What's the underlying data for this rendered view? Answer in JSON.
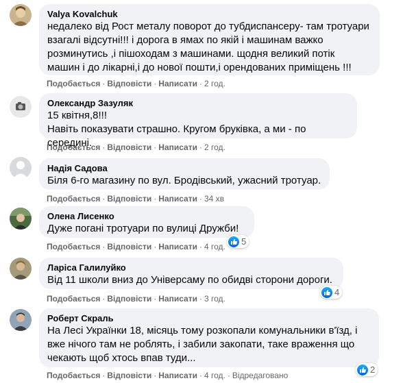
{
  "actions": {
    "like": "Подобається",
    "reply": "Відповісти",
    "write": "Написати",
    "edited": "Відредаговано"
  },
  "comments": [
    {
      "author": "Valya Kovalchuk",
      "lines": [
        "недалеко від Рост металу поворот до тубдиспансеру- там тротуари",
        "взагалі відсутні!!! і дорога в ямах по якій і машинам важко",
        "розминутись ,і пішоходам з машинами. щодня великий потік",
        "машин і до лікарні,і до нової пошти,і орендованих приміщень !!!"
      ],
      "time": "2 год."
    },
    {
      "author": "Олександр Зазуляк",
      "lines": [
        "15 квітня,8!!!",
        "Навіть показувати страшно. Кругом бруківка, а ми - по середині."
      ],
      "time": "2 год."
    },
    {
      "author": "Надія Садова",
      "lines": [
        "Біля 6-го магазину по вул. Бродівський, ужасний тротуар."
      ],
      "time": "34 хв"
    },
    {
      "author": "Олена Лисенко",
      "lines": [
        "Дуже погані тротуари по вулиці Дружби!"
      ],
      "time": "4 год.",
      "reactions": "5"
    },
    {
      "author": "Ларіса Галилуйко",
      "lines": [
        "Від 11 школи вниз до Універсаму по обидві сторони дороги."
      ],
      "time": "3 год.",
      "reactions": "4"
    },
    {
      "author": "Роберт Скраль",
      "lines": [
        "На Лесі Українки 18, місяць тому розкопали комунальники в'їзд, і",
        "вже нічого там не роблять, і забили закопати, таке враження що",
        "чекають щоб хтось впав туди..."
      ],
      "time": "4 год.",
      "reactions": "2"
    }
  ]
}
